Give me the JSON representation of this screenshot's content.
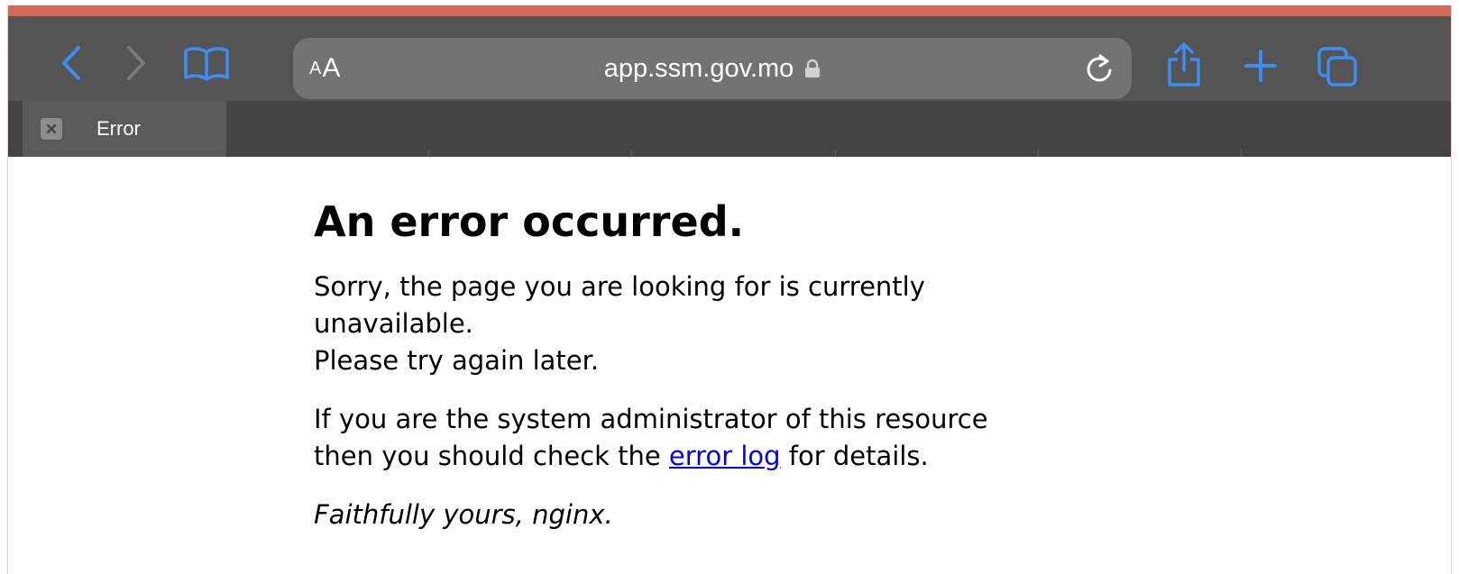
{
  "colors": {
    "accent": "#d46a55",
    "toolbar_bg": "#545454",
    "tab_bar_bg": "#444444",
    "icon_blue": "#3b8df5",
    "link": "#0000ee"
  },
  "toolbar": {
    "back_icon": "chevron-left-icon",
    "forward_icon": "chevron-right-icon",
    "bookmarks_icon": "book-icon",
    "reader_label_small": "A",
    "reader_label_large": "A",
    "url": "app.ssm.gov.mo",
    "secure_icon": "lock-icon",
    "reload_icon": "reload-icon",
    "share_icon": "share-icon",
    "new_tab_icon": "plus-icon",
    "tabs_icon": "tabs-icon"
  },
  "tab": {
    "title": "Error",
    "close_icon": "close-icon"
  },
  "page": {
    "title": "An error occurred.",
    "line_1": "Sorry, the page you are looking for is currently",
    "line_2": "unavailable.",
    "line_3": "Please try again later.",
    "admin_line_1": "If you are the system administrator of this resource",
    "admin_line_2_before": "then you should check the ",
    "link_text": "error log",
    "admin_line_2_after": " for details.",
    "signature": "Faithfully yours, nginx."
  }
}
